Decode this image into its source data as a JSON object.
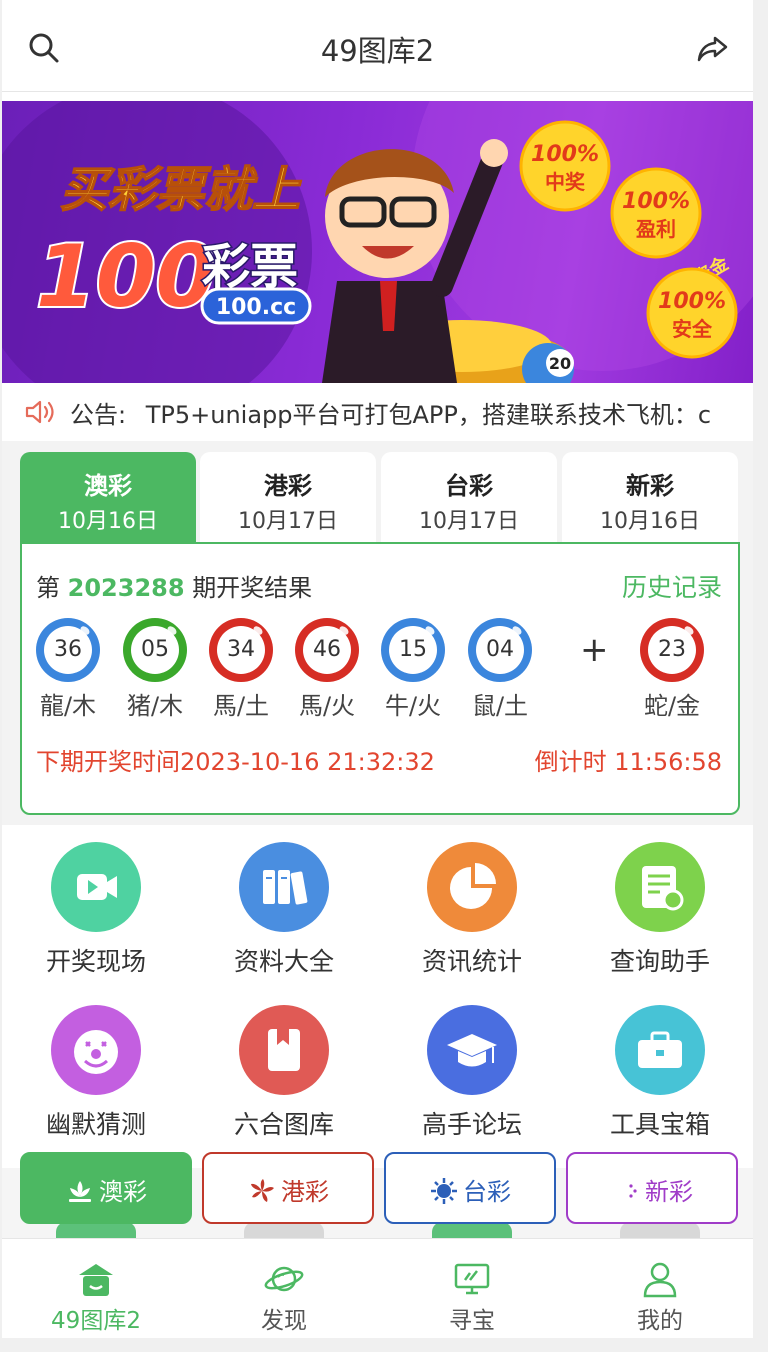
{
  "header": {
    "title": "49图库2"
  },
  "banner": {
    "slogan": "买彩票就上",
    "brand_number": "100",
    "brand_name": "彩票",
    "domain": "100.cc",
    "badges": [
      {
        "pct": "100%",
        "text": "中奖"
      },
      {
        "pct": "100%",
        "text": "盈利"
      },
      {
        "pct": "100%",
        "text": "安全"
      }
    ],
    "badge_note": "资金",
    "ball_number": "20"
  },
  "notice": {
    "label": "公告:",
    "text": "TP5+uniapp平台可打包APP，搭建联系技术飞机：c"
  },
  "tabs": [
    {
      "name": "澳彩",
      "date": "10月16日"
    },
    {
      "name": "港彩",
      "date": "10月17日"
    },
    {
      "name": "台彩",
      "date": "10月17日"
    },
    {
      "name": "新彩",
      "date": "10月16日"
    }
  ],
  "result": {
    "prefix": "第",
    "period": "2023288",
    "suffix": "期开奖结果",
    "history": "历史记录",
    "balls": [
      {
        "num": "36",
        "label": "龍/木",
        "color": "blue"
      },
      {
        "num": "05",
        "label": "猪/木",
        "color": "green"
      },
      {
        "num": "34",
        "label": "馬/土",
        "color": "red"
      },
      {
        "num": "46",
        "label": "馬/火",
        "color": "red"
      },
      {
        "num": "15",
        "label": "牛/火",
        "color": "blue"
      },
      {
        "num": "04",
        "label": "鼠/土",
        "color": "blue"
      }
    ],
    "plus": "+",
    "special": {
      "num": "23",
      "label": "蛇/金",
      "color": "red"
    },
    "next_draw": "下期开奖时间2023-10-16 21:32:32",
    "countdown": "倒计时 11:56:58"
  },
  "menu": [
    {
      "label": "开奖现场",
      "icon": "video-icon",
      "color": "#4fd2a1"
    },
    {
      "label": "资料大全",
      "icon": "books-icon",
      "color": "#4a8ee0"
    },
    {
      "label": "资讯统计",
      "icon": "pie-chart-icon",
      "color": "#ef8a3a"
    },
    {
      "label": "查询助手",
      "icon": "document-search-icon",
      "color": "#7ed24c"
    },
    {
      "label": "幽默猜测",
      "icon": "clown-icon",
      "color": "#c35fe0"
    },
    {
      "label": "六合图库",
      "icon": "book-icon",
      "color": "#e05a55"
    },
    {
      "label": "高手论坛",
      "icon": "graduation-cap-icon",
      "color": "#4a6ee0"
    },
    {
      "label": "工具宝箱",
      "icon": "briefcase-icon",
      "color": "#47c3d6"
    }
  ],
  "regions": [
    {
      "label": "澳彩",
      "color": "#4cb862"
    },
    {
      "label": "港彩",
      "color": "#c0392b"
    },
    {
      "label": "台彩",
      "color": "#2c5fb8"
    },
    {
      "label": "新彩",
      "color": "#a03cc8"
    }
  ],
  "bottom_nav": [
    {
      "label": "49图库2",
      "icon": "home-icon"
    },
    {
      "label": "发现",
      "icon": "planet-icon"
    },
    {
      "label": "寻宝",
      "icon": "monitor-icon"
    },
    {
      "label": "我的",
      "icon": "user-icon"
    }
  ]
}
